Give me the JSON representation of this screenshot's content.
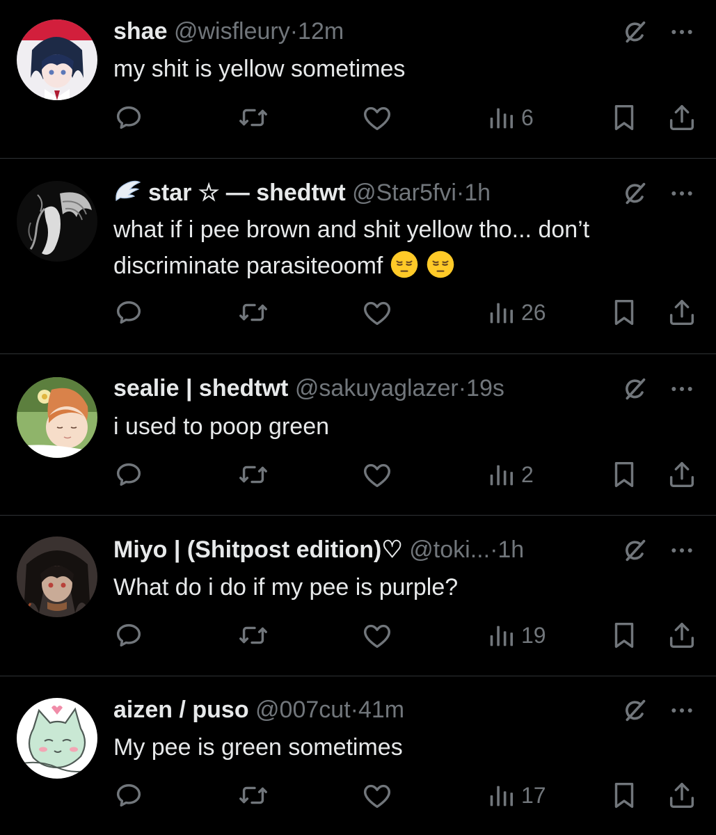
{
  "colors": {
    "background": "#000000",
    "primary_text": "#e7e9ea",
    "secondary_text": "#71767b",
    "divider": "#2f3336"
  },
  "icons": {
    "top_right": [
      "grok-icon",
      "more-icon"
    ],
    "actions": [
      "reply-icon",
      "retweet-icon",
      "like-icon",
      "views-icon",
      "bookmark-icon",
      "share-icon"
    ]
  },
  "tweets": [
    {
      "name": "shae",
      "handle": "@wisfleury",
      "dot": "·",
      "time": "12m",
      "text": "my shit is yellow sometimes",
      "views": "6"
    },
    {
      "name": "star ☆ — shedtwt",
      "handle": "@Star5fvi",
      "dot": "·",
      "time": "1h",
      "text": "what if i pee brown and shit yellow tho... don’t discriminate parasiteoomf",
      "emoji": [
        "pensive-face",
        "pensive-face"
      ],
      "views": "26"
    },
    {
      "name": "sealie | shedtwt",
      "handle": "@sakuyaglazer",
      "dot": "·",
      "time": "19s",
      "text": "i used to poop green",
      "views": "2"
    },
    {
      "name": "Miyo | (Shitpost edition)♡",
      "handle": "@toki...",
      "dot": "·",
      "time": "1h",
      "text": "What do i do if my pee is purple?",
      "views": "19"
    },
    {
      "name": "aizen / puso",
      "handle": "@007cut",
      "dot": "·",
      "time": "41m",
      "text": "My pee is green sometimes",
      "views": "17"
    }
  ]
}
